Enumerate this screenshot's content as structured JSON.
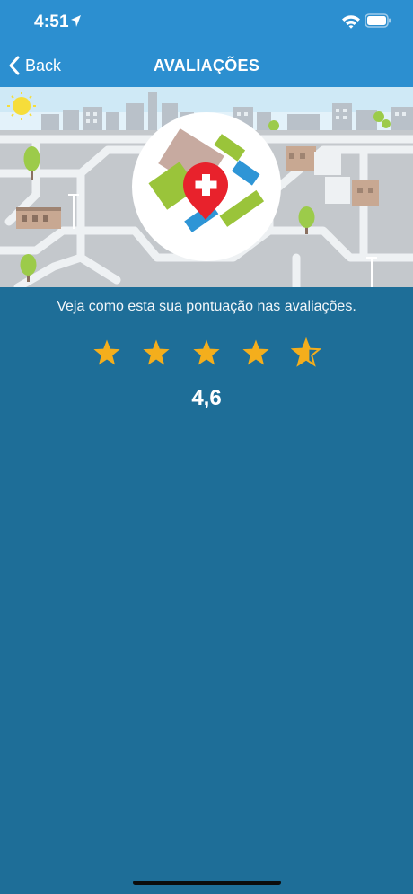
{
  "status_bar": {
    "time": "4:51"
  },
  "nav": {
    "back_label": "Back",
    "title": "AVALIAÇÕES"
  },
  "banner": {
    "icon": "hospital-map-pin-logo"
  },
  "rating": {
    "description": "Veja como esta sua pontuação nas avaliações.",
    "value_text": "4,6",
    "value": 4.6,
    "max": 5,
    "star_color": "#f4ae1c"
  },
  "colors": {
    "header": "#2c8fd0",
    "background": "#1e6e98",
    "pin_red": "#e8222c"
  }
}
